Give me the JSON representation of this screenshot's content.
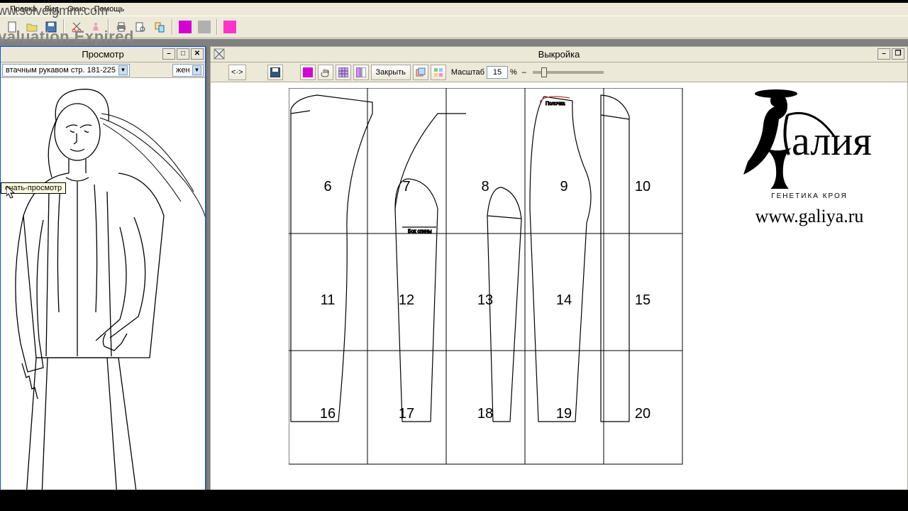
{
  "watermark": {
    "url": "ww.solveigmm.com",
    "eval": "valuation Expired"
  },
  "menu": {
    "edit": "Правка",
    "view": "Вид",
    "window": "Окно",
    "help": "Помощь"
  },
  "colors": {
    "magenta": "#d400d4",
    "gray": "#808080",
    "magenta2": "#ff33cc"
  },
  "preview": {
    "title": "Просмотр",
    "combo_model": "втачным рукавом стр. 181-225",
    "combo_gender": "жен",
    "tooltip": "ечать-просмотр"
  },
  "pattern": {
    "title": "Выкройка",
    "btn_close": "Закрыть",
    "scale_label": "Масштаб",
    "scale_value": "15",
    "scale_pct": "%",
    "page_numbers": [
      "6",
      "7",
      "8",
      "9",
      "10",
      "11",
      "12",
      "13",
      "14",
      "15",
      "16",
      "17",
      "18",
      "19",
      "20"
    ],
    "piece_label": "Бок спины",
    "piece_label2": "Полочка"
  },
  "brand": {
    "name": "Галия",
    "sub": "ГЕНЕТИКА КРОЯ",
    "url": "www.galiya.ru"
  },
  "winbtn": {
    "min": "–",
    "max": "□",
    "restore": "❐",
    "close": "✕"
  },
  "toolbar_glyph": {
    "back_fwd": "<·>"
  }
}
